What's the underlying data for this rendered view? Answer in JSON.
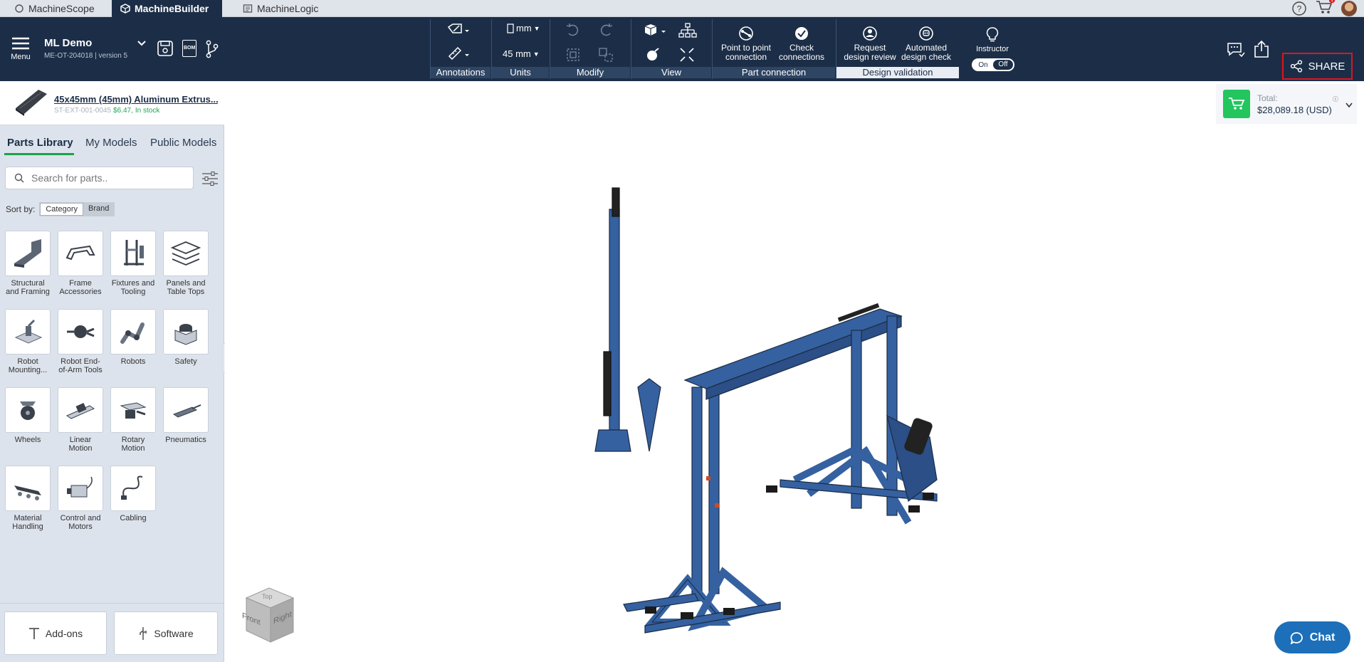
{
  "tabs": [
    {
      "label": "MachineScope"
    },
    {
      "label": "MachineBuilder"
    },
    {
      "label": "MachineLogic"
    }
  ],
  "cart_badge": "1",
  "header": {
    "menu_label": "Menu",
    "project_name": "ML Demo",
    "project_meta": "ME-OT-204018 | version 5",
    "bom_label": "BOM"
  },
  "toolbar": {
    "annotations_label": "Annotations",
    "units_value": "mm",
    "units_size": "45 mm",
    "units_label": "Units",
    "modify_label": "Modify",
    "view_label": "View",
    "point_to_point": "Point to point connection",
    "check_connections": "Check connections",
    "part_connection_label": "Part connection",
    "request_review": "Request design review",
    "automated_check": "Automated design check",
    "design_validation_label": "Design validation",
    "instructor_label": "Instructor",
    "on_label": "On",
    "off_label": "Off",
    "share_label": "SHARE"
  },
  "selected_part": {
    "name": "45x45mm (45mm) Aluminum Extrus...",
    "sku": "ST-EXT-001-0045",
    "price": "$6.47,",
    "stock": "In stock"
  },
  "library": {
    "tabs": [
      {
        "label": "Parts Library"
      },
      {
        "label": "My Models"
      },
      {
        "label": "Public Models"
      }
    ],
    "search_placeholder": "Search for parts..",
    "sort_by": "Sort by:",
    "sort_options": [
      {
        "label": "Category"
      },
      {
        "label": "Brand"
      }
    ],
    "categories": [
      {
        "l1": "Structural",
        "l2": "and Framing"
      },
      {
        "l1": "Frame",
        "l2": "Accessories"
      },
      {
        "l1": "Fixtures and",
        "l2": "Tooling"
      },
      {
        "l1": "Panels and",
        "l2": "Table Tops"
      },
      {
        "l1": "Robot",
        "l2": "Mounting..."
      },
      {
        "l1": "Robot End-",
        "l2": "of-Arm Tools"
      },
      {
        "l1": "Robots",
        "l2": ""
      },
      {
        "l1": "Safety",
        "l2": ""
      },
      {
        "l1": "Wheels",
        "l2": ""
      },
      {
        "l1": "Linear",
        "l2": "Motion"
      },
      {
        "l1": "Rotary",
        "l2": "Motion"
      },
      {
        "l1": "Pneumatics",
        "l2": ""
      },
      {
        "l1": "Material",
        "l2": "Handling"
      },
      {
        "l1": "Control and",
        "l2": "Motors"
      },
      {
        "l1": "Cabling",
        "l2": ""
      }
    ],
    "addons_label": "Add-ons",
    "software_label": "Software"
  },
  "total": {
    "label": "Total:",
    "value": "$28,089.18 (USD)"
  },
  "viewcube": {
    "front": "Front",
    "right": "Right",
    "top": "Top"
  },
  "chat_label": "Chat",
  "colors": {
    "navy": "#1c2e47",
    "accent_green": "#22c55e",
    "share_highlight": "#e0141e",
    "machine_blue": "#3561a0"
  }
}
